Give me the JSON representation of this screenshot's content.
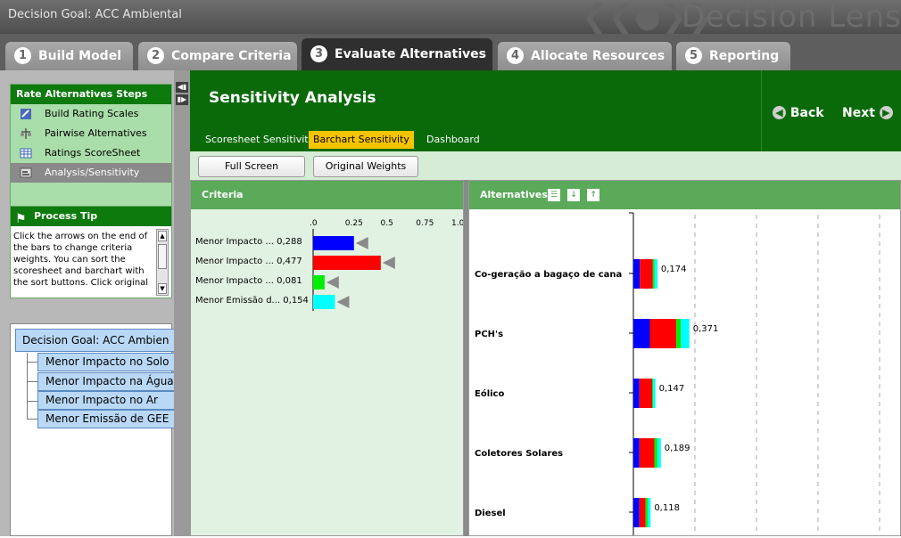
{
  "window": {
    "title": "Decision Goal: ACC Ambiental",
    "brand": "Decision Lens"
  },
  "tabs": [
    {
      "num": "1",
      "label": "Build Model"
    },
    {
      "num": "2",
      "label": "Compare Criteria"
    },
    {
      "num": "3",
      "label": "Evaluate Alternatives"
    },
    {
      "num": "4",
      "label": "Allocate Resources"
    },
    {
      "num": "5",
      "label": "Reporting"
    }
  ],
  "steps": {
    "title": "Rate Alternatives Steps",
    "items": [
      {
        "label": "Build Rating Scales",
        "icon": "ruler-icon"
      },
      {
        "label": "Pairwise Alternatives",
        "icon": "scale-icon"
      },
      {
        "label": "Ratings ScoreSheet",
        "icon": "grid-icon"
      },
      {
        "label": "Analysis/Sensitivity",
        "icon": "chart-icon"
      }
    ]
  },
  "tip": {
    "title": "Process Tip",
    "text": "Click the arrows on the end of the bars to change criteria weights.  You can sort the scoresheet and barchart with the sort buttons.  Click original"
  },
  "tree": {
    "root": "Decision Goal: ACC Ambien",
    "children": [
      "Menor Impacto no Solo",
      "Menor Impacto na Água",
      "Menor Impacto no Ar",
      "Menor Emissão de GEE"
    ]
  },
  "main": {
    "title": "Sensitivity Analysis",
    "subtabs": [
      "Scoresheet Sensitivity",
      "Barchart Sensitivity",
      "Dashboard"
    ],
    "back": "Back",
    "next": "Next",
    "full_screen": "Full Screen",
    "original_weights": "Original Weights"
  },
  "criteria": {
    "title": "Criteria",
    "axis_ticks": [
      ".0",
      "0.25",
      "0.5",
      "0.75",
      "1.0"
    ],
    "items": [
      {
        "label": "Menor Impacto ...",
        "value": "0,288",
        "weight": 0.288,
        "color": "#0000ff"
      },
      {
        "label": "Menor Impacto ...",
        "value": "0,477",
        "weight": 0.477,
        "color": "#ff0000"
      },
      {
        "label": "Menor Impacto ...",
        "value": "0,081",
        "weight": 0.081,
        "color": "#00ee00"
      },
      {
        "label": "Menor Emissão d...",
        "value": "0,154",
        "weight": 0.154,
        "color": "#00ffff"
      }
    ]
  },
  "alternatives": {
    "title": "Alternatives",
    "items": [
      {
        "label": "Co-geração a bagaço de cana",
        "total": "0,174",
        "segments": [
          0.026,
          0.052,
          0.007,
          0.011
        ]
      },
      {
        "label": "PCH's",
        "total": "0,371",
        "segments": [
          0.066,
          0.106,
          0.018,
          0.034
        ]
      },
      {
        "label": "Eólico",
        "total": "0,147",
        "segments": [
          0.024,
          0.051,
          0.004,
          0.009
        ]
      },
      {
        "label": "Coletores Solares",
        "total": "0,189",
        "segments": [
          0.024,
          0.06,
          0.012,
          0.014
        ]
      },
      {
        "label": "Diesel",
        "total": "0,118",
        "segments": [
          0.024,
          0.025,
          0.009,
          0.011
        ]
      }
    ],
    "colors": [
      "#0000ff",
      "#ff0000",
      "#00ee00",
      "#00ffff"
    ]
  }
}
